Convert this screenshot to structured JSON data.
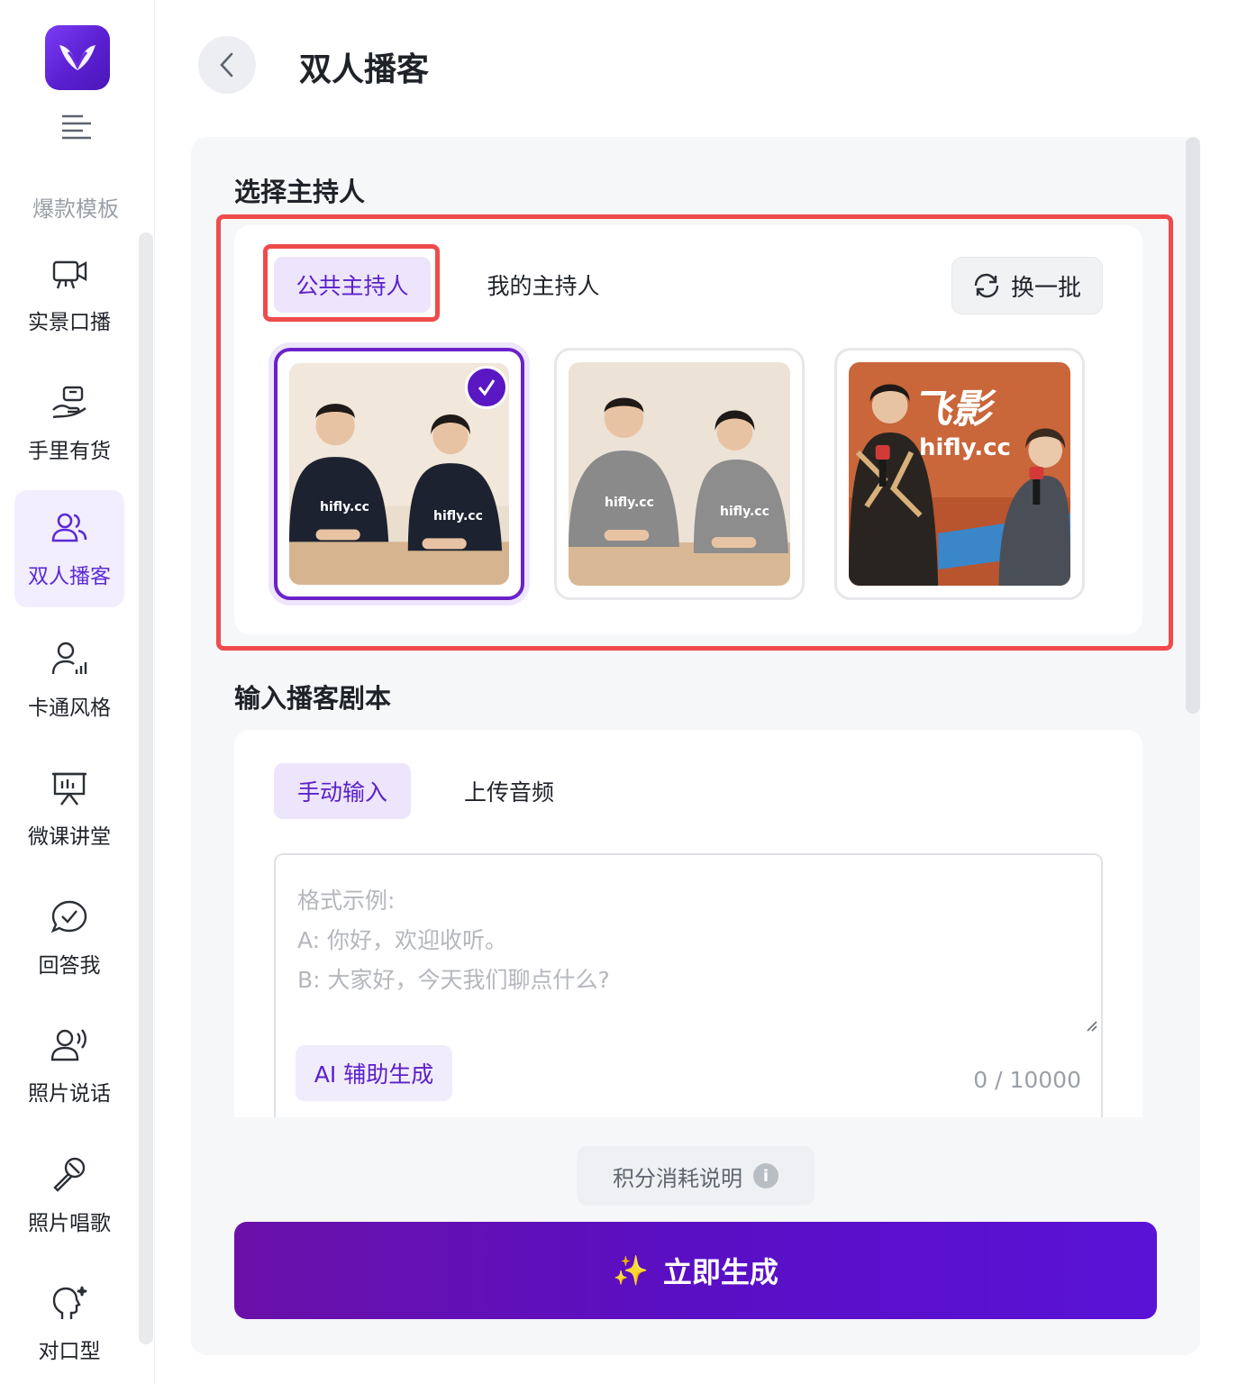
{
  "sidebar": {
    "section_label": "爆款模板",
    "items": [
      {
        "label": "实景口播",
        "icon": "camera-screen-icon"
      },
      {
        "label": "手里有货",
        "icon": "hand-product-icon"
      },
      {
        "label": "双人播客",
        "icon": "two-people-icon",
        "active": true
      },
      {
        "label": "卡通风格",
        "icon": "person-signal-icon"
      },
      {
        "label": "微课讲堂",
        "icon": "presentation-board-icon"
      },
      {
        "label": "回答我",
        "icon": "chat-check-icon"
      },
      {
        "label": "照片说话",
        "icon": "person-voice-icon"
      },
      {
        "label": "照片唱歌",
        "icon": "microphone-icon"
      },
      {
        "label": "对口型",
        "icon": "head-sparkle-icon"
      }
    ]
  },
  "header": {
    "title": "双人播客"
  },
  "host_section": {
    "heading": "选择主持人",
    "tabs": [
      "公共主持人",
      "我的主持人"
    ],
    "active_tab": "公共主持人",
    "refresh_label": "换一批",
    "hosts": [
      {
        "shirt_text": "hifly.cc",
        "selected": true
      },
      {
        "shirt_text": "hifly.cc",
        "selected": false
      },
      {
        "banner_text": "飞影",
        "banner_sub": "hifly.cc",
        "selected": false
      }
    ]
  },
  "script_section": {
    "heading": "输入播客剧本",
    "tabs": [
      "手动输入",
      "上传音频"
    ],
    "active_tab": "手动输入",
    "placeholder_lines": [
      "格式示例:",
      "A: 你好，欢迎收听。",
      "B: 大家好，今天我们聊点什么?"
    ],
    "ai_button": "AI 辅助生成",
    "char_count": "0 / 10000"
  },
  "footer": {
    "cost_label": "积分消耗说明",
    "cost_info_glyph": "i",
    "generate_label": "立即生成",
    "generate_icon": "✨"
  },
  "colors": {
    "accent": "#5b20c9",
    "highlight": "#ef4b4b",
    "button": "#5a0fc4"
  }
}
